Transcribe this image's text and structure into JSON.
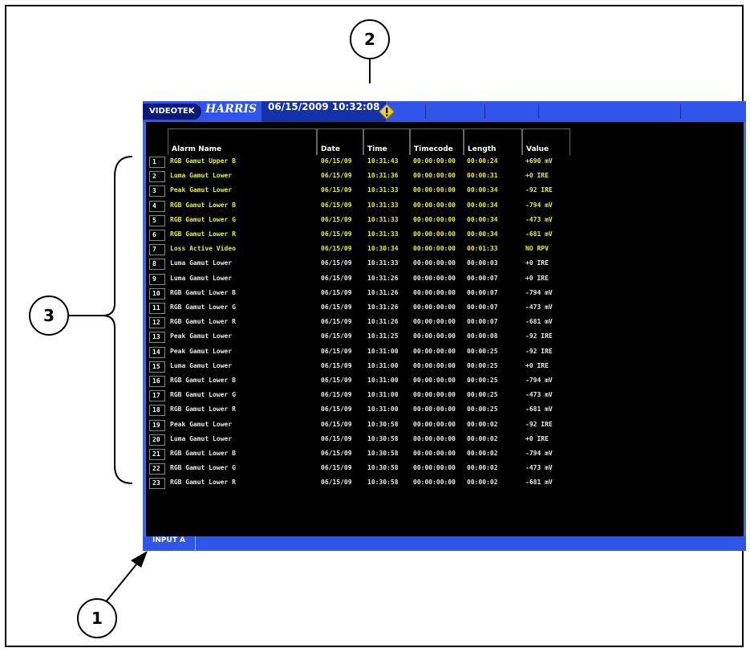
{
  "callouts": [
    "1",
    "2",
    "3"
  ],
  "header": {
    "logo_text": "VIDEOTEK",
    "logo2_text": "HARRIS",
    "datetime": "06/15/2009 10:32:08",
    "alert_icon": "warning-icon"
  },
  "table": {
    "columns": [
      "Alarm Name",
      "Date",
      "Time",
      "Timecode",
      "Length",
      "Value"
    ],
    "rows": [
      {
        "num": "1",
        "name": "RGB Gamut Upper B",
        "date": "06/15/09",
        "time": "10:31:43",
        "timecode": "00:00:00:00",
        "length": "00:00:24",
        "value": "+690 mV",
        "state": "active"
      },
      {
        "num": "2",
        "name": "Luma Gamut Lower",
        "date": "06/15/09",
        "time": "10:31:36",
        "timecode": "00:00:00:00",
        "length": "00:00:31",
        "value": "+0 IRE",
        "state": "active"
      },
      {
        "num": "3",
        "name": "Peak Gamut Lower",
        "date": "06/15/09",
        "time": "10:31:33",
        "timecode": "00:00:00:00",
        "length": "00:00:34",
        "value": "-92 IRE",
        "state": "active"
      },
      {
        "num": "4",
        "name": "RGB Gamut Lower B",
        "date": "06/15/09",
        "time": "10:31:33",
        "timecode": "00:00:00:00",
        "length": "00:00:34",
        "value": "-794 mV",
        "state": "active"
      },
      {
        "num": "5",
        "name": "RGB Gamut Lower G",
        "date": "06/15/09",
        "time": "10:31:33",
        "timecode": "00:00:00:00",
        "length": "00:00:34",
        "value": "-473 mV",
        "state": "active"
      },
      {
        "num": "6",
        "name": "RGB Gamut Lower R",
        "date": "06/15/09",
        "time": "10:31:33",
        "timecode": "00:00:00:00",
        "length": "00:00:34",
        "value": "-681 mV",
        "state": "active"
      },
      {
        "num": "7",
        "name": "Loss Active Video",
        "date": "06/15/09",
        "time": "10:30:34",
        "timecode": "00:00:00:00",
        "length": "00:01:33",
        "value": "NO RPV",
        "state": "active"
      },
      {
        "num": "8",
        "name": "Luma Gamut Lower",
        "date": "06/15/09",
        "time": "10:31:33",
        "timecode": "00:00:00:00",
        "length": "00:00:03",
        "value": "+0 IRE",
        "state": "inactive"
      },
      {
        "num": "9",
        "name": "Luma Gamut Lower",
        "date": "06/15/09",
        "time": "10:31:26",
        "timecode": "00:00:00:00",
        "length": "00:00:07",
        "value": "+0 IRE",
        "state": "inactive"
      },
      {
        "num": "10",
        "name": "RGB Gamut Lower B",
        "date": "06/15/09",
        "time": "10:31:26",
        "timecode": "00:00:00:00",
        "length": "00:00:07",
        "value": "-794 mV",
        "state": "inactive"
      },
      {
        "num": "11",
        "name": "RGB Gamut Lower G",
        "date": "06/15/09",
        "time": "10:31:26",
        "timecode": "00:00:00:00",
        "length": "00:00:07",
        "value": "-473 mV",
        "state": "inactive"
      },
      {
        "num": "12",
        "name": "RGB Gamut Lower R",
        "date": "06/15/09",
        "time": "10:31:26",
        "timecode": "00:00:00:00",
        "length": "00:00:07",
        "value": "-681 mV",
        "state": "inactive"
      },
      {
        "num": "13",
        "name": "Peak Gamut Lower",
        "date": "06/15/09",
        "time": "10:31:25",
        "timecode": "00:00:00:00",
        "length": "00:00:08",
        "value": "-92 IRE",
        "state": "inactive"
      },
      {
        "num": "14",
        "name": "Peak Gamut Lower",
        "date": "06/15/09",
        "time": "10:31:00",
        "timecode": "00:00:00:00",
        "length": "00:00:25",
        "value": "-92 IRE",
        "state": "inactive"
      },
      {
        "num": "15",
        "name": "Luma Gamut Lower",
        "date": "06/15/09",
        "time": "10:31:00",
        "timecode": "00:00:00:00",
        "length": "00:00:25",
        "value": "+0 IRE",
        "state": "inactive"
      },
      {
        "num": "16",
        "name": "RGB Gamut Lower B",
        "date": "06/15/09",
        "time": "10:31:00",
        "timecode": "00:00:00:00",
        "length": "00:00:25",
        "value": "-794 mV",
        "state": "inactive"
      },
      {
        "num": "17",
        "name": "RGB Gamut Lower G",
        "date": "06/15/09",
        "time": "10:31:00",
        "timecode": "00:00:00:00",
        "length": "00:00:25",
        "value": "-473 mV",
        "state": "inactive"
      },
      {
        "num": "18",
        "name": "RGB Gamut Lower R",
        "date": "06/15/09",
        "time": "10:31:00",
        "timecode": "00:00:00:00",
        "length": "00:00:25",
        "value": "-681 mV",
        "state": "inactive"
      },
      {
        "num": "19",
        "name": "Peak Gamut Lower",
        "date": "06/15/09",
        "time": "10:30:58",
        "timecode": "00:00:00:00",
        "length": "00:00:02",
        "value": "-92 IRE",
        "state": "inactive"
      },
      {
        "num": "20",
        "name": "Luma Gamut Lower",
        "date": "06/15/09",
        "time": "10:30:58",
        "timecode": "00:00:00:00",
        "length": "00:00:02",
        "value": "+0 IRE",
        "state": "inactive"
      },
      {
        "num": "21",
        "name": "RGB Gamut Lower B",
        "date": "06/15/09",
        "time": "10:30:58",
        "timecode": "00:00:00:00",
        "length": "00:00:02",
        "value": "-794 mV",
        "state": "inactive"
      },
      {
        "num": "22",
        "name": "RGB Gamut Lower G",
        "date": "06/15/09",
        "time": "10:30:58",
        "timecode": "00:00:00:00",
        "length": "00:00:02",
        "value": "-473 mV",
        "state": "inactive"
      },
      {
        "num": "23",
        "name": "RGB Gamut Lower R",
        "date": "06/15/09",
        "time": "10:30:58",
        "timecode": "00:00:00:00",
        "length": "00:00:02",
        "value": "-681 mV",
        "state": "inactive"
      }
    ]
  },
  "statusbar": {
    "input_label": "INPUT A"
  },
  "colors": {
    "bar_blue": "#2f56e8",
    "active_text": "#e8ee2a",
    "inactive_text": "#e8e8e8"
  }
}
